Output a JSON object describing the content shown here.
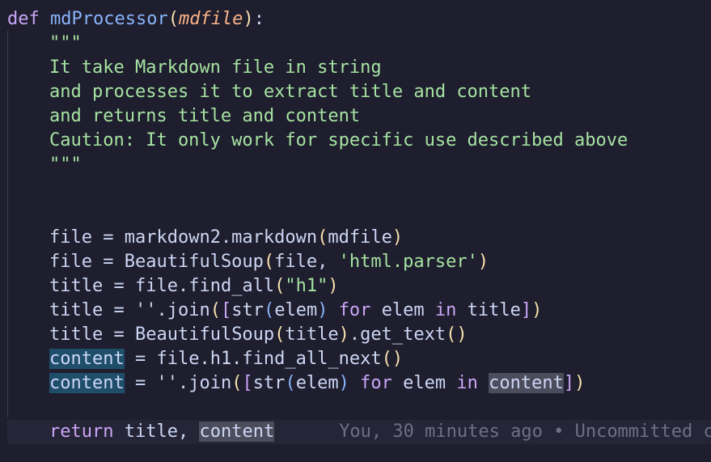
{
  "code": {
    "kw_def": "def",
    "fn_name": "mdProcessor",
    "paren_open": "(",
    "param": "mdfile",
    "paren_close": ")",
    "colon": ":",
    "doc_quotes_open": "\"\"\"",
    "doc_line_1": "It take Markdown file in string",
    "doc_line_2": "and processes it to extract title and content",
    "doc_line_3": "and returns title and content",
    "doc_line_4": "Caution: It only work for specific use described above",
    "doc_quotes_close": "\"\"\"",
    "var_file": "file",
    "var_title": "title",
    "var_content": "content",
    "op_assign": " = ",
    "markdown_call": "markdown2.markdown",
    "arg_mdfile": "mdfile",
    "beautifulsoup": "BeautifulSoup",
    "arg_file": "file",
    "comma_space": ", ",
    "str_html_parser": "'html.parser'",
    "file_find_all": "file.find_all",
    "str_h1": "\"h1\"",
    "empty_str_join": "''.join",
    "bracket_open": "[",
    "bracket_close": "]",
    "builtin_str": "str",
    "elem": "elem",
    "kw_for": "for",
    "kw_in": "in",
    "get_text": ".get_text",
    "empty_call": "()",
    "file_h1_find_all_next": "file.h1.find_all_next",
    "kw_return": "return",
    "return_title": "title",
    "return_comma": ", ",
    "space": " "
  },
  "blame": {
    "text": "You, 30 minutes ago • Uncommitted c"
  },
  "colors": {
    "background": "#1e1e2e",
    "keyword": "#cba6f7",
    "function": "#89b4fa",
    "parameter": "#fab387",
    "string": "#a6e3a1",
    "bracket_1": "#f9e2af",
    "bracket_2": "#cba6f7",
    "bracket_3": "#89b4fa",
    "selection": "#1f4e6b",
    "occurrence": "#4b4d5c"
  }
}
